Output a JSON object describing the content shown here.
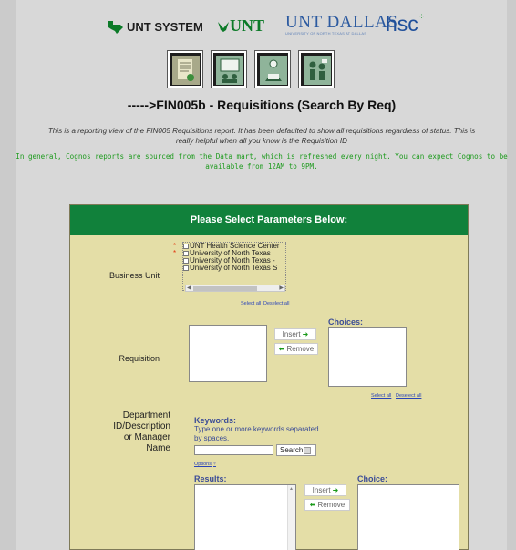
{
  "logos": {
    "unt_system": "UNT SYSTEM",
    "unt": "UNT",
    "unt_dallas": "UNT DALLAS",
    "unt_dallas_sub": "UNIVERSITY OF NORTH TEXAS AT DALLAS",
    "hsc": "hsc"
  },
  "report_icons": [
    "report-document-icon",
    "presentation-icon",
    "graduate-icon",
    "people-icon"
  ],
  "page_title": "----->FIN005b - Requisitions (Search By Req)",
  "description": "This is a reporting view of the FIN005 Requisitions report. It has been defaulted to show all requisitions regardless of status. This is really helpful when all you know is the Requisition ID",
  "cognos_note": "In general, Cognos reports are sourced from the Data mart, which is refreshed every night. You can expect Cognos to be available from 12AM to 9PM.",
  "panel": {
    "header": "Please Select Parameters Below:",
    "business_unit": {
      "label": "Business Unit",
      "options": [
        "UNT Health Science Center",
        "University of North Texas",
        "University of North Texas -",
        "University of North Texas S"
      ],
      "select_all": "Select all",
      "deselect_all": "Deselect all"
    },
    "requisition": {
      "label": "Requisition",
      "insert": "Insert",
      "remove": "Remove",
      "choices_label": "Choices:",
      "select_all": "Select all",
      "deselect_all": "Deselect all"
    },
    "department": {
      "label_lines": [
        "Department",
        "ID/Description",
        "or Manager",
        "Name"
      ],
      "keywords_label": "Keywords:",
      "keywords_help": "Type one or more keywords separated by spaces.",
      "search_button": "Search",
      "options_link": "Options",
      "results_label": "Results:",
      "insert": "Insert",
      "remove": "Remove",
      "choice_label": "Choice:"
    }
  },
  "colors": {
    "panel_header_bg": "#11813b",
    "panel_bg": "#e4dea7",
    "note_green": "#1d9a1d",
    "link_blue": "#2a44b8"
  }
}
